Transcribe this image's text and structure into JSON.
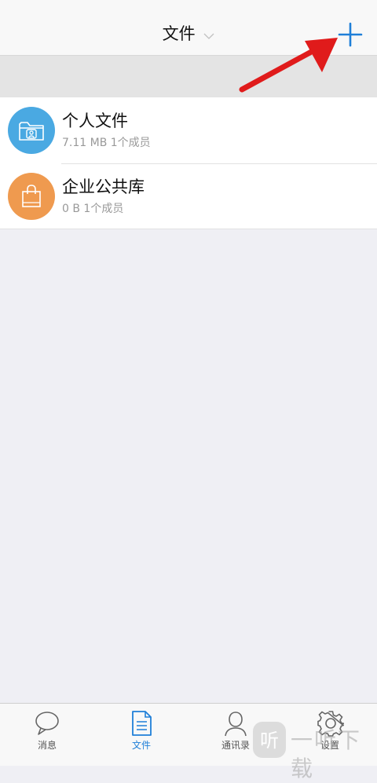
{
  "header": {
    "title": "文件"
  },
  "files": [
    {
      "name": "个人文件",
      "meta": "7.11 MB 1个成员",
      "icon": "folder-person-icon",
      "color": "#4aa9e2"
    },
    {
      "name": "企业公共库",
      "meta": "0 B 1个成员",
      "icon": "shopping-bag-icon",
      "color": "#ef9a4f"
    }
  ],
  "tabs": [
    {
      "label": "消息",
      "icon": "chat-bubble-icon",
      "active": false
    },
    {
      "label": "文件",
      "icon": "document-icon",
      "active": true
    },
    {
      "label": "通讯录",
      "icon": "person-icon",
      "active": false
    },
    {
      "label": "设置",
      "icon": "gear-icon",
      "active": false
    }
  ],
  "colors": {
    "accent": "#1f7fd8",
    "annotation_arrow": "#e01b1b"
  },
  "watermark": {
    "text": "一听下载",
    "logo_glyph": "听"
  }
}
